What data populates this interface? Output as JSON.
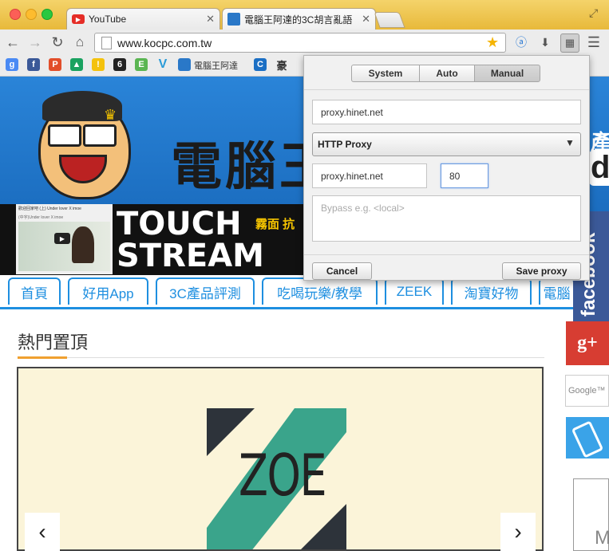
{
  "browser": {
    "tabs": [
      {
        "title": "YouTube",
        "icon": "youtube-icon"
      },
      {
        "title": "電腦王阿達的3C胡言亂語",
        "icon": "site-favicon"
      }
    ],
    "url": "www.kocpc.com.tw",
    "bookmark_label": "電腦王阿達"
  },
  "site": {
    "banner_brand": "電腦王",
    "banner_right_text": "產",
    "banner_right_logo": "di",
    "ad_text_line1": "TOUCH",
    "ad_text_line2": "STREAM",
    "ad_side_text": "霧面 抗",
    "video_title": "歡迎回家吧 (上) Under lover X imoe",
    "video_subtitle": "(中字)Under lover X imoe",
    "nav": [
      "首頁",
      "好用App",
      "3C產品評測",
      "吃喝玩樂/教學",
      "ZEEK",
      "淘寶好物",
      "電腦"
    ],
    "hot_title": "熱門置頂",
    "slide_text": "ZOE",
    "prev_arrow": "‹",
    "next_arrow": "›"
  },
  "sidebar": {
    "facebook_label": "facebook",
    "gplus_label": "g+",
    "google_label": "Google™",
    "m_label": "M"
  },
  "proxy_popup": {
    "modes": [
      "System",
      "Auto",
      "Manual"
    ],
    "active_mode": "Manual",
    "pac_url": "proxy.hinet.net",
    "proxy_type": "HTTP Proxy",
    "host": "proxy.hinet.net",
    "port": "80",
    "bypass_placeholder": "Bypass e.g. <local>",
    "cancel_label": "Cancel",
    "save_label": "Save proxy"
  },
  "colors": {
    "brand_blue": "#1e8fe0",
    "facebook_blue": "#3b5998",
    "gplus_red": "#d73d32",
    "zoe_teal": "#3aa48b"
  }
}
